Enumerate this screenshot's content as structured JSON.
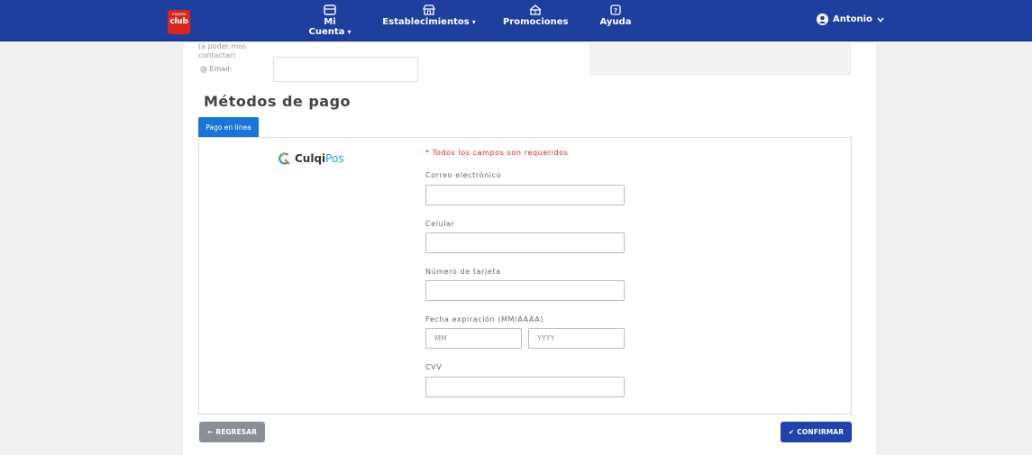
{
  "navbar": {
    "logo_top": "mayorsa",
    "logo_text": "club",
    "items": [
      {
        "label": "Mi Cuenta",
        "has_caret": true,
        "icon": "card-icon"
      },
      {
        "label": "Establecimientos",
        "has_caret": true,
        "icon": "store-icon"
      },
      {
        "label": "Promociones",
        "has_caret": false,
        "icon": "gift-icon"
      },
      {
        "label": "Ayuda",
        "has_caret": false,
        "icon": "help-icon"
      }
    ],
    "user_name": "Antonio",
    "caret": "▾"
  },
  "contact": {
    "partial_label_1": "(a poder mos",
    "partial_label_2": "contactar)",
    "email_label": "@ Email:"
  },
  "payment": {
    "title": "Métodos de pago",
    "tab_label": "Pago en linea",
    "provider_brand": "Culqi",
    "provider_suffix": "Pos",
    "required_note": "* Todos los campos son requeridos",
    "fields": {
      "email_label": "Correo electrónico",
      "phone_label": "Celular",
      "card_label": "Número de tarjeta",
      "expiry_label": "Fecha expiración (MM/AAAA)",
      "month_placeholder": "MM",
      "year_placeholder": "YYYY",
      "cvv_label": "CVV"
    }
  },
  "actions": {
    "back_label": "REGRESAR",
    "confirm_label": "CONFIRMAR"
  },
  "colors": {
    "nav_bg": "#1f3f9f",
    "tab_bg": "#1b74d8",
    "confirm_bg": "#1f43a8",
    "back_bg": "#8a8f96",
    "required": "#d9251c"
  }
}
